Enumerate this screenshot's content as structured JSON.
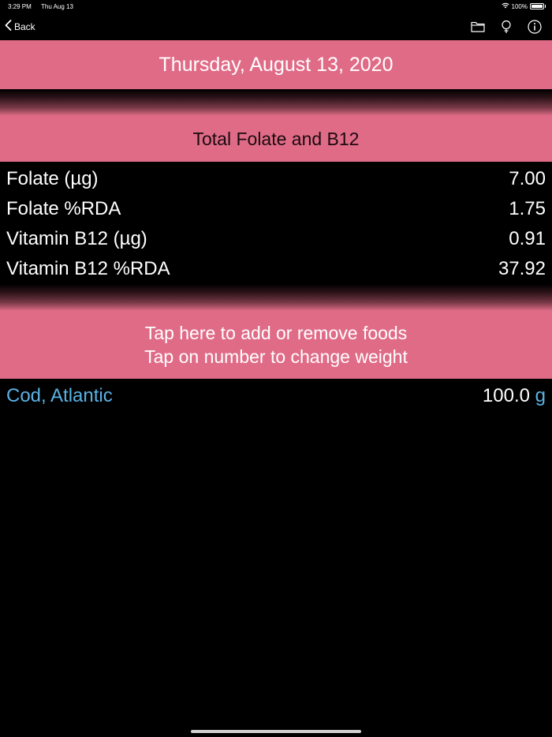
{
  "status_bar": {
    "time": "3:29 PM",
    "date": "Thu Aug 13",
    "battery": "100%",
    "battery_level": 1.0
  },
  "nav": {
    "back_label": "Back",
    "icons": [
      "folder-icon",
      "lightbulb-icon",
      "info-icon"
    ]
  },
  "date_banner": "Thursday, August 13, 2020",
  "section_title": "Total Folate and B12",
  "nutrients": [
    {
      "name": "Folate (µg)",
      "value": "7.00"
    },
    {
      "name": "Folate %RDA",
      "value": "1.75"
    },
    {
      "name": "Vitamin B12 (µg)",
      "value": "0.91"
    },
    {
      "name": "Vitamin B12 %RDA",
      "value": "37.92"
    }
  ],
  "foods_banner": {
    "line1": "Tap here to add or remove foods",
    "line2": "Tap on number to change weight"
  },
  "foods": [
    {
      "name": "Cod, Atlantic",
      "weight": "100.0",
      "unit": "g"
    }
  ],
  "colors": {
    "accent_pink": "#e06b87",
    "link_blue": "#5ab2e6",
    "background": "#000000"
  }
}
